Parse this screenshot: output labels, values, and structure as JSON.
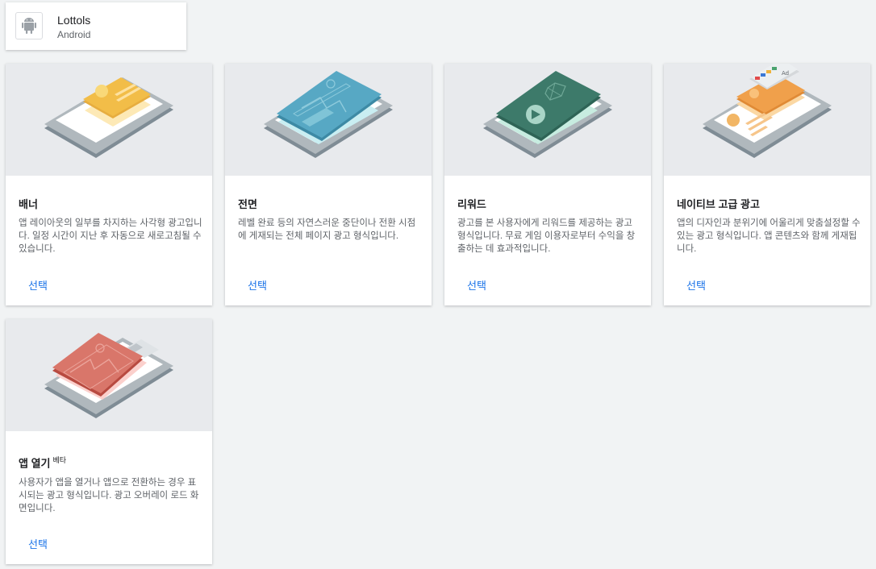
{
  "app": {
    "name": "Lottols",
    "platform": "Android",
    "icon": "android-icon"
  },
  "cards": [
    {
      "id": "banner",
      "title": "배너",
      "badge": "",
      "description": "앱 레이아웃의 일부를 차지하는 사각형 광고입니다. 일정 시간이 지난 후 자동으로 새로고침될 수 있습니다.",
      "action": "선택",
      "accent": "#f2bd48"
    },
    {
      "id": "interstitial",
      "title": "전면",
      "badge": "",
      "description": "레벨 완료 등의 자연스러운 중단이나 전환 시점에 게재되는 전체 페이지 광고 형식입니다.",
      "action": "선택",
      "accent": "#57a8c4"
    },
    {
      "id": "rewarded",
      "title": "리워드",
      "badge": "",
      "description": "광고를 본 사용자에게 리워드를 제공하는 광고 형식입니다. 무료 게임 이용자로부터 수익을 창출하는 데 효과적입니다.",
      "action": "선택",
      "accent": "#3d7a6a"
    },
    {
      "id": "native-advanced",
      "title": "네이티브 고급 광고",
      "badge": "",
      "description": "앱의 디자인과 분위기에 어울리게 맞춤설정할 수 있는 광고 형식입니다. 앱 콘텐츠와 함께 게재됩니다.",
      "action": "선택",
      "accent": "#f0a04b"
    },
    {
      "id": "app-open",
      "title": "앱 열기",
      "badge": "베타",
      "description": "사용자가 앱을 열거나 앱으로 전환하는 경우 표시되는 광고 형식입니다. 광고 오버레이 로드 화면입니다.",
      "action": "선택",
      "accent": "#d9766a"
    }
  ]
}
